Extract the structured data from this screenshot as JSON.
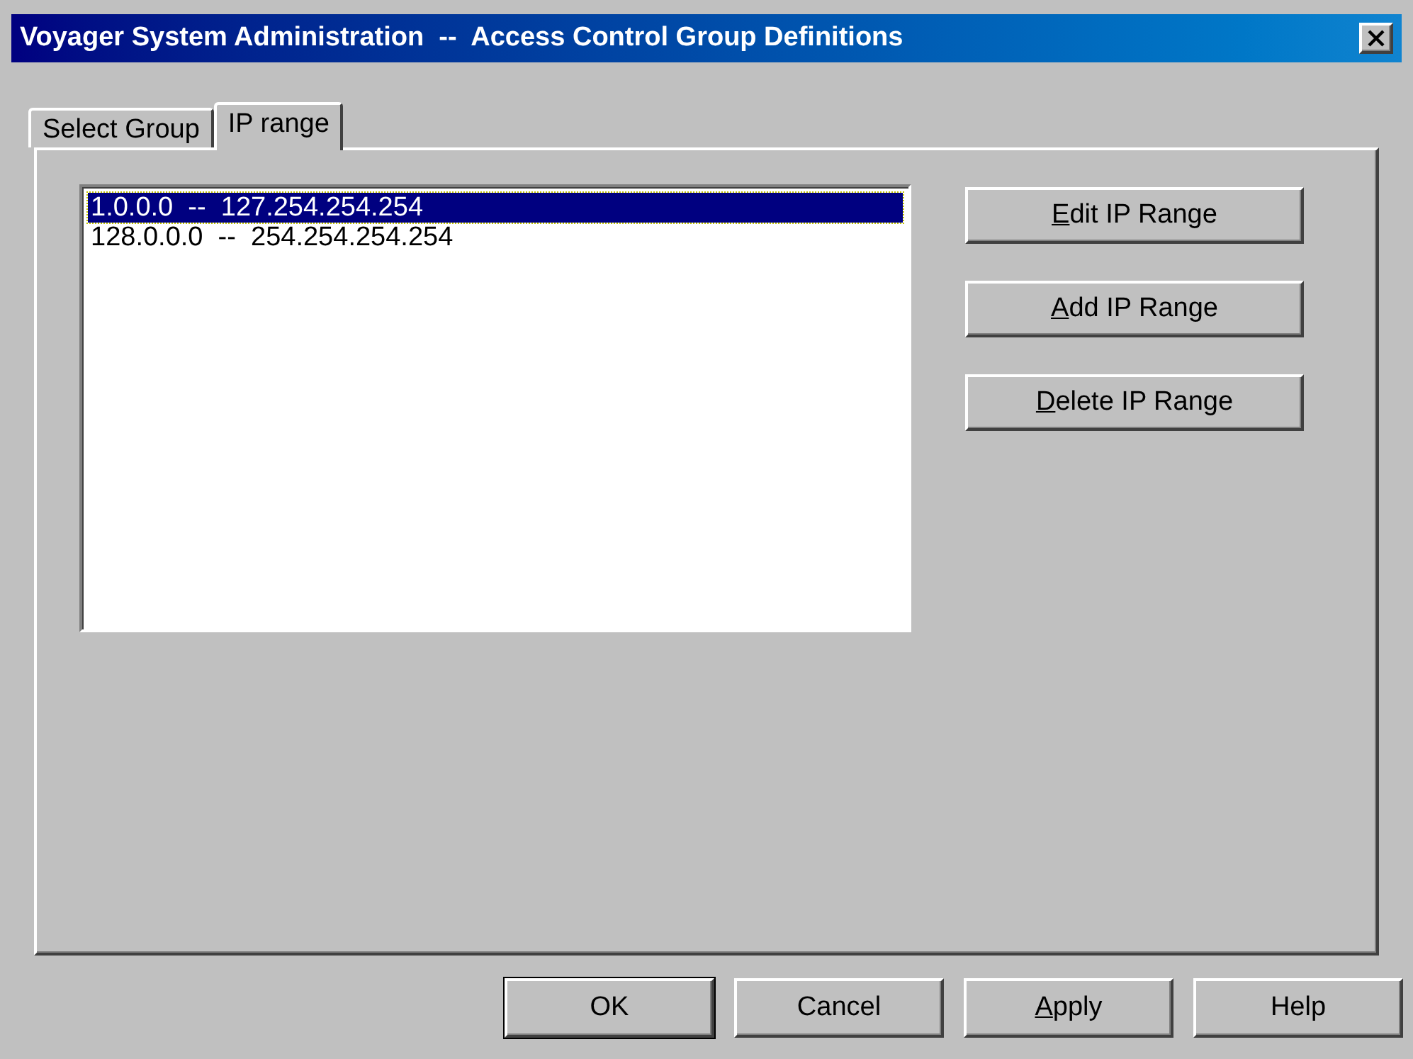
{
  "window": {
    "title": "Voyager System Administration  --  Access Control Group Definitions"
  },
  "tabs": [
    {
      "label": "Select Group",
      "selected": false
    },
    {
      "label": "IP range",
      "selected": true
    }
  ],
  "ip_ranges": [
    {
      "text": "1.0.0.0  --  127.254.254.254",
      "selected": true
    },
    {
      "text": "128.0.0.0  --  254.254.254.254",
      "selected": false
    }
  ],
  "side_buttons": [
    {
      "accel": "E",
      "rest": "dit IP Range"
    },
    {
      "accel": "A",
      "rest": "dd IP Range"
    },
    {
      "accel": "D",
      "rest": "elete IP Range"
    }
  ],
  "dialog_buttons": [
    {
      "rest": "OK",
      "default": true
    },
    {
      "rest": "Cancel",
      "default": false
    },
    {
      "accel": "A",
      "rest": "pply",
      "default": false
    },
    {
      "rest": "Help",
      "default": false
    }
  ]
}
